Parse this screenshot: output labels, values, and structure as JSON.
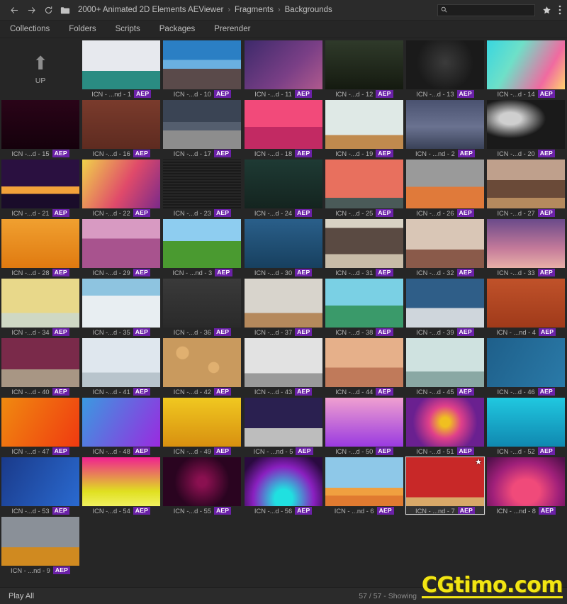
{
  "window": {
    "background": "#262626",
    "accent": "#6b21a8"
  },
  "topbar": {
    "back_icon": "arrow-left-icon",
    "forward_icon": "arrow-right-icon",
    "reload_icon": "reload-icon",
    "folder_icon": "folder-icon",
    "breadcrumb": [
      "2000+ Animated 2D Elements AEViewer",
      "Fragments",
      "Backgrounds"
    ],
    "separator": "›",
    "search": {
      "value": "",
      "placeholder": "",
      "icon": "search-icon"
    },
    "star_icon": "star-icon",
    "menu_icon": "vertical-dots-icon"
  },
  "menu": {
    "items": [
      "Collections",
      "Folders",
      "Scripts",
      "Packages",
      "Prerender"
    ]
  },
  "grid": {
    "up": {
      "label": "UP",
      "icon": "arrow-up-icon"
    },
    "badge": "AEP",
    "favorite_icon": "star-filled-icon",
    "items": [
      {
        "label": "ICN - ...nd - 1",
        "art": "a1"
      },
      {
        "label": "ICN -...d - 10",
        "art": "a10"
      },
      {
        "label": "ICN -...d - 11",
        "art": "a11"
      },
      {
        "label": "ICN -...d - 12",
        "art": "a12"
      },
      {
        "label": "ICN -...d - 13",
        "art": "a13"
      },
      {
        "label": "ICN -...d - 14",
        "art": "a14"
      },
      {
        "label": "ICN -...d - 15",
        "art": "a15"
      },
      {
        "label": "ICN -...d - 16",
        "art": "a16"
      },
      {
        "label": "ICN -...d - 17",
        "art": "a17"
      },
      {
        "label": "ICN -...d - 18",
        "art": "a18"
      },
      {
        "label": "ICN -...d - 19",
        "art": "a19"
      },
      {
        "label": "ICN - ...nd - 2",
        "art": "a2"
      },
      {
        "label": "ICN -...d - 20",
        "art": "a20"
      },
      {
        "label": "ICN -...d - 21",
        "art": "a21"
      },
      {
        "label": "ICN -...d - 22",
        "art": "a22"
      },
      {
        "label": "ICN -...d - 23",
        "art": "a23"
      },
      {
        "label": "ICN -...d - 24",
        "art": "a24"
      },
      {
        "label": "ICN -...d - 25",
        "art": "a25"
      },
      {
        "label": "ICN -...d - 26",
        "art": "a26"
      },
      {
        "label": "ICN -...d - 27",
        "art": "a27"
      },
      {
        "label": "ICN -...d - 28",
        "art": "a28"
      },
      {
        "label": "ICN -...d - 29",
        "art": "a29"
      },
      {
        "label": "ICN - ...nd - 3",
        "art": "a3"
      },
      {
        "label": "ICN -...d - 30",
        "art": "a30"
      },
      {
        "label": "ICN -...d - 31",
        "art": "a31"
      },
      {
        "label": "ICN -...d - 32",
        "art": "a32"
      },
      {
        "label": "ICN -...d - 33",
        "art": "a33"
      },
      {
        "label": "ICN -...d - 34",
        "art": "a34"
      },
      {
        "label": "ICN -...d - 35",
        "art": "a35"
      },
      {
        "label": "ICN -...d - 36",
        "art": "a36"
      },
      {
        "label": "ICN -...d - 37",
        "art": "a37"
      },
      {
        "label": "ICN -...d - 38",
        "art": "a38"
      },
      {
        "label": "ICN -...d - 39",
        "art": "a39"
      },
      {
        "label": "ICN - ...nd - 4",
        "art": "a4"
      },
      {
        "label": "ICN -...d - 40",
        "art": "a40"
      },
      {
        "label": "ICN -...d - 41",
        "art": "a41"
      },
      {
        "label": "ICN -...d - 42",
        "art": "a42"
      },
      {
        "label": "ICN -...d - 43",
        "art": "a43"
      },
      {
        "label": "ICN -...d - 44",
        "art": "a44"
      },
      {
        "label": "ICN -...d - 45",
        "art": "a45"
      },
      {
        "label": "ICN -...d - 46",
        "art": "a46"
      },
      {
        "label": "ICN -...d - 47",
        "art": "a47"
      },
      {
        "label": "ICN -...d - 48",
        "art": "a48"
      },
      {
        "label": "ICN -...d - 49",
        "art": "a49"
      },
      {
        "label": "ICN - ...nd - 5",
        "art": "a5"
      },
      {
        "label": "ICN -...d - 50",
        "art": "a50"
      },
      {
        "label": "ICN -...d - 51",
        "art": "a51"
      },
      {
        "label": "ICN -...d - 52",
        "art": "a52"
      },
      {
        "label": "ICN -...d - 53",
        "art": "a53"
      },
      {
        "label": "ICN -...d - 54",
        "art": "a54"
      },
      {
        "label": "ICN -...d - 55",
        "art": "a55"
      },
      {
        "label": "ICN -...d - 56",
        "art": "a56"
      },
      {
        "label": "ICN - ...nd - 6",
        "art": "a6"
      },
      {
        "label": "ICN - ...nd - 7",
        "art": "a7",
        "selected": true,
        "favorite": true
      },
      {
        "label": "ICN - ...nd - 8",
        "art": "a8"
      },
      {
        "label": "ICN - ...nd - 9",
        "art": "a9"
      }
    ]
  },
  "bottombar": {
    "play_all": "Play All",
    "status": "57 / 57 - Showing"
  },
  "watermark": {
    "text": "CGtimo.com",
    "color": "#f2e513"
  }
}
